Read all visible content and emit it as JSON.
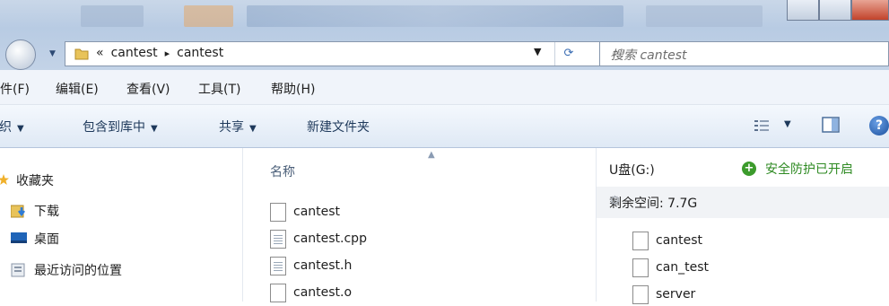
{
  "address": {
    "crumbs": [
      "«",
      "cantest",
      "▸",
      "cantest"
    ]
  },
  "search": {
    "placeholder": "搜索 cantest"
  },
  "menu": [
    "件(F)",
    "编辑(E)",
    "查看(V)",
    "工具(T)",
    "帮助(H)"
  ],
  "commands": {
    "organize": "组织",
    "include_library": "包含到库中",
    "share": "共享",
    "new_folder": "新建文件夹"
  },
  "nav": {
    "favorites": "收藏夹",
    "items": [
      "下载",
      "桌面",
      "最近访问的位置"
    ]
  },
  "filelist": {
    "column_name": "名称",
    "files": [
      "cantest",
      "cantest.cpp",
      "cantest.h",
      "cantest.o"
    ]
  },
  "details": {
    "drive": "U盘(G:)",
    "protection": "安全防护已开启",
    "free_space": "剩余空间: 7.7G",
    "items": [
      "cantest",
      "can_test",
      "server"
    ]
  },
  "icons": {
    "nav_back": "back-arrow-icon",
    "refresh": "refresh-icon",
    "search": "search-icon",
    "view": "view-options-icon",
    "preview": "preview-pane-icon",
    "help": "help-icon"
  }
}
